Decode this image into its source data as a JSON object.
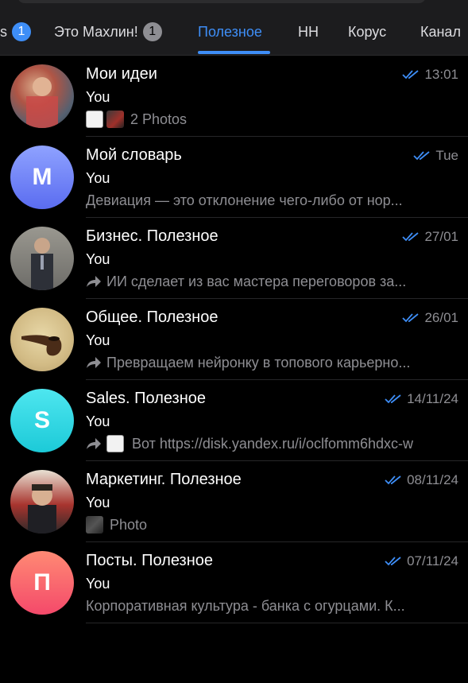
{
  "tabs": [
    {
      "label": "s",
      "badge": "1",
      "badge_color": "#3e8ef7"
    },
    {
      "label": "Это Махлин!",
      "badge": "1",
      "badge_color": "#8e8e93"
    },
    {
      "label": "Полезное",
      "active": true
    },
    {
      "label": "НН"
    },
    {
      "label": "Корус"
    },
    {
      "label": "Канал"
    }
  ],
  "chats": [
    {
      "title": "Мои идеи",
      "time": "13:01",
      "sender": "You",
      "preview": "2 Photos",
      "avatar_letter": ""
    },
    {
      "title": "Мой словарь",
      "time": "Tue",
      "sender": "You",
      "preview": "Девиация — это отклонение чего-либо от нор...",
      "avatar_letter": "M"
    },
    {
      "title": "Бизнес. Полезное",
      "time": "27/01",
      "sender": "You",
      "preview": "ИИ сделает из вас мастера переговоров за...",
      "avatar_letter": ""
    },
    {
      "title": "Общее. Полезное",
      "time": "26/01",
      "sender": "You",
      "preview": "Превращаем нейронку в топового карьерно...",
      "avatar_letter": ""
    },
    {
      "title": "Sales. Полезное",
      "time": "14/11/24",
      "sender": "You",
      "preview": "Вот https://disk.yandex.ru/i/oclfomm6hdxc-w",
      "avatar_letter": "S"
    },
    {
      "title": "Маркетинг. Полезное",
      "time": "08/11/24",
      "sender": "You",
      "preview": "Photo",
      "avatar_letter": ""
    },
    {
      "title": "Посты. Полезное",
      "time": "07/11/24",
      "sender": "You",
      "preview": "Корпоративная культура - банка с огурцами. К...",
      "avatar_letter": "П"
    }
  ],
  "colors": {
    "accent": "#3e8ef7",
    "read_check": "#3e8ef7",
    "muted": "#8e8e93"
  }
}
